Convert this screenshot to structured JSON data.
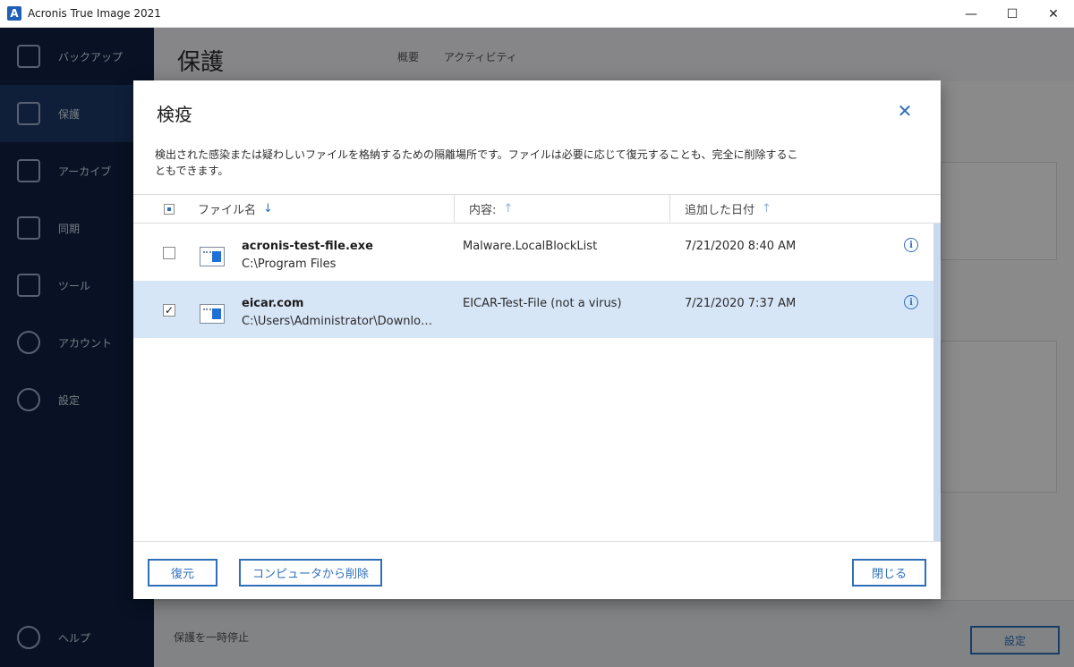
{
  "window": {
    "app_icon": "A",
    "title": "Acronis True Image 2021",
    "minimize_glyph": "—",
    "maximize_glyph": "☐",
    "close_glyph": "✕"
  },
  "background": {
    "sidebar_items": [
      {
        "label": "バックアップ",
        "icon": "backup-icon"
      },
      {
        "label": "保護",
        "icon": "shield-icon"
      },
      {
        "label": "アーカイブ",
        "icon": "archive-icon"
      },
      {
        "label": "同期",
        "icon": "sync-icon"
      },
      {
        "label": "ツール",
        "icon": "tools-icon"
      },
      {
        "label": "アカウント",
        "icon": "account-icon"
      },
      {
        "label": "設定",
        "icon": "settings-icon"
      }
    ],
    "help_label": "ヘルプ",
    "main_title": "保護",
    "tabs": [
      "概要",
      "アクティビティ"
    ],
    "pause_label": "保護を一時停止",
    "settings_button": "設定"
  },
  "dialog": {
    "title": "検疫",
    "close_glyph": "✕",
    "description": "検出された感染または疑わしいファイルを格納するための隔離場所です。ファイルは必要に応じて復元することも、完全に削除することもできます。",
    "columns": [
      {
        "label": "ファイル名",
        "arrow": "↓"
      },
      {
        "label": "内容:",
        "arrow": "↑"
      },
      {
        "label": "追加した日付",
        "arrow": "↑"
      }
    ],
    "rows": [
      {
        "checked": false,
        "name": "acronis-test-file.exe",
        "path": "C:\\Program Files",
        "content": "Malware.LocalBlockList",
        "date": "7/21/2020 8:40 AM"
      },
      {
        "checked": true,
        "name": "eicar.com",
        "path": "C:\\Users\\Administrator\\Downloads",
        "content": "EICAR-Test-File (not a virus)",
        "date": "7/21/2020 7:37 AM"
      }
    ],
    "info_glyph": "i",
    "check_glyph": "✓",
    "buttons": {
      "restore": "復元",
      "delete": "コンピュータから削除",
      "close": "閉じる"
    }
  }
}
